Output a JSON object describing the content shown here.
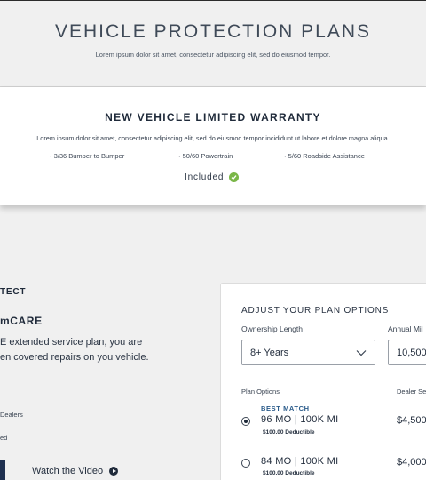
{
  "hero": {
    "title": "VEHICLE PROTECTION PLANS",
    "subtitle": "Lorem ipsum dolor sit amet, consectetur adipiscing elit, sed do eiusmod tempor."
  },
  "warranty": {
    "title": "NEW VEHICLE LIMITED WARRANTY",
    "description": "Lorem ipsum dolor sit amet, consectetur adipiscing elit, sed do eiusmod tempor incididunt ut labore et dolore magna aliqua.",
    "features": [
      "· 3/36 Bumper to Bumper",
      "· 50/60 Powertrain",
      "· 5/60 Roadside Assistance"
    ],
    "included_label": "Included",
    "included_icon": "check-circle-icon",
    "accent_color": "#7ab648"
  },
  "left": {
    "heading": "TECT",
    "brand": "mCARE",
    "line1": "E extended service plan, you are",
    "line2": "en covered repairs on you vehicle.",
    "item1": "Dealers",
    "item2": "ed",
    "video_label": "Watch the Video"
  },
  "panel": {
    "title": "ADJUST YOUR PLAN OPTIONS",
    "ownership_label": "Ownership Length",
    "ownership_value": "8+ Years",
    "mileage_label": "Annual Mil",
    "mileage_value": "10,500",
    "plan_options_label": "Plan Options",
    "dealer_label": "Dealer Se",
    "best_match": "BEST MATCH",
    "plans": [
      {
        "label": "96 MO | 100K MI",
        "deductible": "$100.00 Deductible",
        "price": "$4,500",
        "selected": true
      },
      {
        "label": "84 MO | 100K MI",
        "deductible": "$100.00 Deductible",
        "price": "$4,000",
        "selected": false
      }
    ]
  }
}
